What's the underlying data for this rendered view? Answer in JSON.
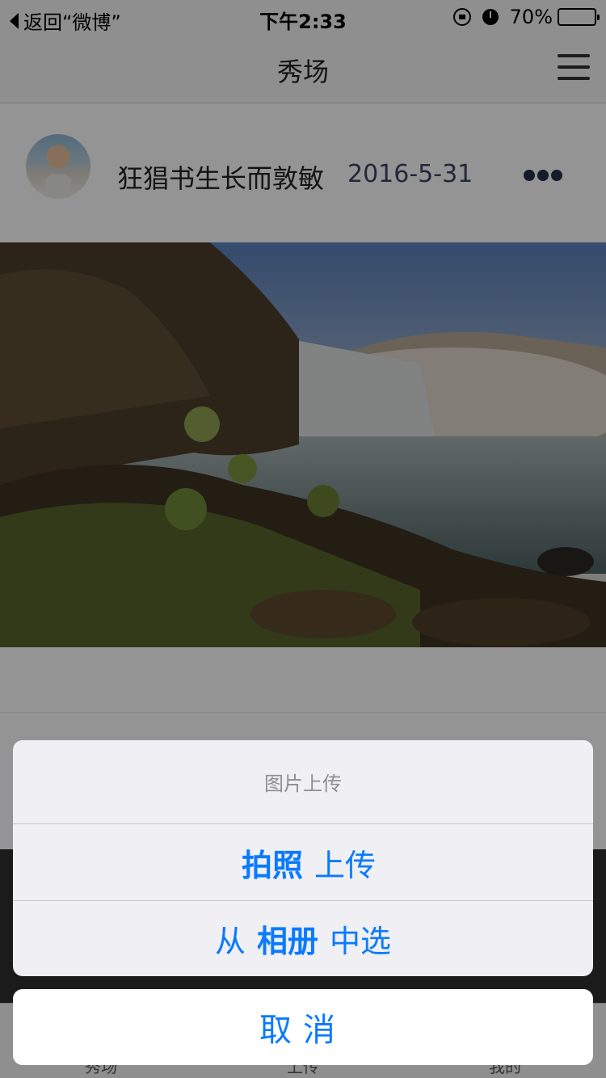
{
  "status_bar": {
    "back_label": "返回“微博”",
    "time": "下午2:33",
    "battery_percent": "70%",
    "battery_level": 0.7,
    "icons": [
      "orientation-lock-icon",
      "alarm-icon",
      "battery-icon"
    ]
  },
  "nav": {
    "title": "秀场",
    "menu_icon": "hamburger-menu-icon"
  },
  "post": {
    "username": "狂猖书生长而敦敏",
    "date": "2016-5-31",
    "more_icon": "more-dots-icon"
  },
  "tab_bar": {
    "items": [
      {
        "label": "秀场"
      },
      {
        "label": "上传"
      },
      {
        "label": "我的"
      }
    ]
  },
  "action_sheet": {
    "title": "图片上传",
    "option1": {
      "bold": "拍照",
      "rest": "上传"
    },
    "option2": {
      "pre": "从",
      "bold": "相册",
      "rest": "中选"
    },
    "cancel": "取消",
    "accent_color": "#0a7aff"
  }
}
